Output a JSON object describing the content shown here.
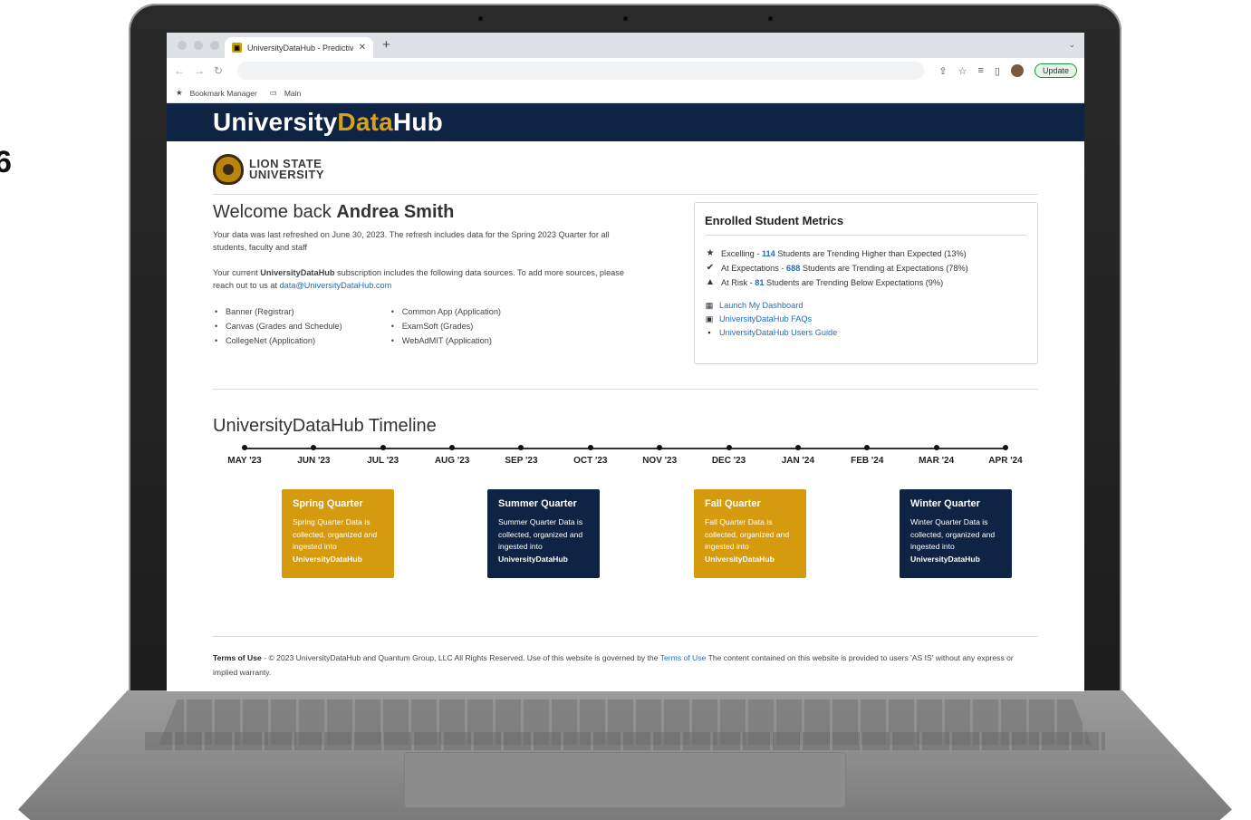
{
  "browser": {
    "tab_title": "UniversityDataHub - Predictive",
    "update_label": "Update",
    "bookmarks": [
      "Bookmark Manager",
      "Main"
    ]
  },
  "brand": {
    "part1": "University",
    "part2": "Data",
    "part3": "Hub"
  },
  "university": {
    "line1": "LION STATE",
    "line2": "UNIVERSITY"
  },
  "welcome": {
    "prefix": "Welcome back ",
    "name": "Andrea Smith",
    "refresh_text": "Your data was last refreshed on June 30, 2023. The refresh includes data for the Spring 2023 Quarter for all students, faculty and staff",
    "sub_prefix": "Your current ",
    "sub_brand": "UniversityDataHub",
    "sub_suffix": " subscription includes the following data sources. To add more sources, please reach out to us at ",
    "email": "data@UniversityDataHub.com"
  },
  "sources": {
    "left": [
      "Banner (Registrar)",
      "Canvas (Grades and Schedule)",
      "CollegeNet (Application)"
    ],
    "right": [
      "Common App (Application)",
      "ExamSoft (Grades)",
      "WebAdMIT (Application)"
    ]
  },
  "metrics": {
    "title": "Enrolled Student Metrics",
    "items": [
      {
        "icon": "star-icon",
        "label": "Excelling - ",
        "num": "114",
        "text": " Students are Trending Higher than Expected (13%)"
      },
      {
        "icon": "check-circle-icon",
        "label": "At Expectations - ",
        "num": "688",
        "text": " Students are Trending at Expectations (78%)"
      },
      {
        "icon": "warning-icon",
        "label": "At Risk - ",
        "num": "81",
        "text": " Students are Trending Below Expectations (9%)"
      }
    ],
    "links": [
      "Launch My Dashboard",
      "UniversityDataHub FAQs",
      "UniversityDataHub Users Guide"
    ]
  },
  "timeline": {
    "title": "UniversityDataHub Timeline",
    "months": [
      "MAY '23",
      "JUN '23",
      "JUL '23",
      "AUG '23",
      "SEP '23",
      "OCT '23",
      "NOV '23",
      "DEC '23",
      "JAN '24",
      "FEB '24",
      "MAR '24",
      "APR '24"
    ],
    "quarters": [
      {
        "title": "Spring Quarter",
        "desc": "Spring Quarter Data is collected, organized and ingested into",
        "brand": "UniversityDataHub",
        "color": "#d59a0d"
      },
      {
        "title": "Summer Quarter",
        "desc": "Summer Quarter Data is collected, organized and ingested into",
        "brand": "UniversityDataHub",
        "color": "#0f2344"
      },
      {
        "title": "Fall Quarter",
        "desc": "Fall Quarter Data is collected, organized and ingested into",
        "brand": "UniversityDataHub",
        "color": "#d59a0d"
      },
      {
        "title": "Winter Quarter",
        "desc": "Winter Quarter Data is collected, organized and ingested into",
        "brand": "UniversityDataHub",
        "color": "#0f2344"
      }
    ]
  },
  "footer": {
    "terms_label": "Terms of Use",
    "text1": " - © 2023 UniversityDataHub and Quantum Group, LLC All Rights Reserved. Use of this website is governed by the ",
    "terms_link": "Terms of Use",
    "text2": " The content contained on this website is provided to users 'AS IS' without any express or implied warranty."
  },
  "colors": {
    "navy": "#0f2344",
    "gold": "#d59a0d",
    "link": "#1a6fc4"
  }
}
